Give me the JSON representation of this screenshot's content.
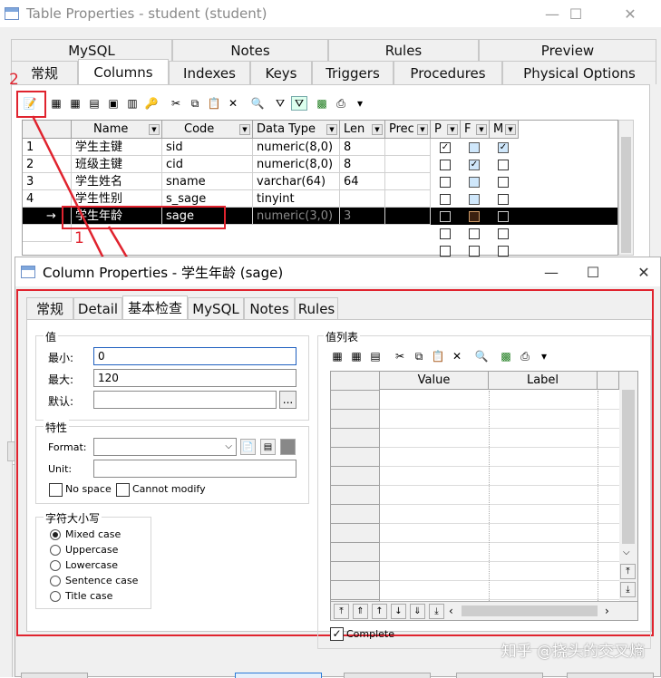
{
  "table_window": {
    "title": "Table Properties - student (student)",
    "tabs_row1": [
      "MySQL",
      "Notes",
      "Rules",
      "Preview"
    ],
    "tabs_row2": [
      "常规",
      "Columns",
      "Indexes",
      "Keys",
      "Triggers",
      "Procedures",
      "Physical Options"
    ],
    "active_tab": "Columns",
    "columns_header": [
      "Name",
      "Code",
      "Data Type",
      "Len",
      "Prec",
      "P",
      "F",
      "M"
    ],
    "rows": [
      {
        "num": "1",
        "name": "学生主键",
        "code": "sid",
        "type": "numeric(8,0)",
        "len": "8",
        "prec": "",
        "p": true,
        "f": false,
        "m": true
      },
      {
        "num": "2",
        "name": "班级主键",
        "code": "cid",
        "type": "numeric(8,0)",
        "len": "8",
        "prec": "",
        "p": false,
        "f": true,
        "m": false
      },
      {
        "num": "3",
        "name": "学生姓名",
        "code": "sname",
        "type": "varchar(64)",
        "len": "64",
        "prec": "",
        "p": false,
        "f": false,
        "m": false
      },
      {
        "num": "4",
        "name": "学生性别",
        "code": "s_sage",
        "type": "tinyint",
        "len": "",
        "prec": "",
        "p": false,
        "f": false,
        "m": false
      },
      {
        "num": "→",
        "name": "学生年龄",
        "code": "sage",
        "type": "numeric(3,0)",
        "len": "3",
        "prec": "",
        "p": false,
        "f": false,
        "m": false
      }
    ]
  },
  "annotations": {
    "marker1": "1",
    "marker2": "2"
  },
  "column_window": {
    "title": "Column Properties - 学生年龄 (sage)",
    "tabs": [
      "常规",
      "Detail",
      "基本检查",
      "MySQL",
      "Notes",
      "Rules"
    ],
    "active_tab": "基本检查",
    "values_group": "值",
    "min_label": "最小:",
    "min_value": "0",
    "max_label": "最大:",
    "max_value": "120",
    "default_label": "默认:",
    "default_value": "",
    "props_group": "特性",
    "format_label": "Format:",
    "unit_label": "Unit:",
    "no_space": "No space",
    "cannot_modify": "Cannot modify",
    "case_group": "字符大小写",
    "case_options": [
      "Mixed case",
      "Uppercase",
      "Lowercase",
      "Sentence case",
      "Title case"
    ],
    "selected_case": "Mixed case",
    "list_group": "值列表",
    "list_headers": [
      "Value",
      "Label"
    ],
    "complete_label": "Complete",
    "ellipsis": "..."
  },
  "watermark": "知乎 @挠头的交叉熵",
  "colors": {
    "accent_red": "#e0232e",
    "selected_row": "#000000",
    "header_bg": "#f0f0f0"
  }
}
